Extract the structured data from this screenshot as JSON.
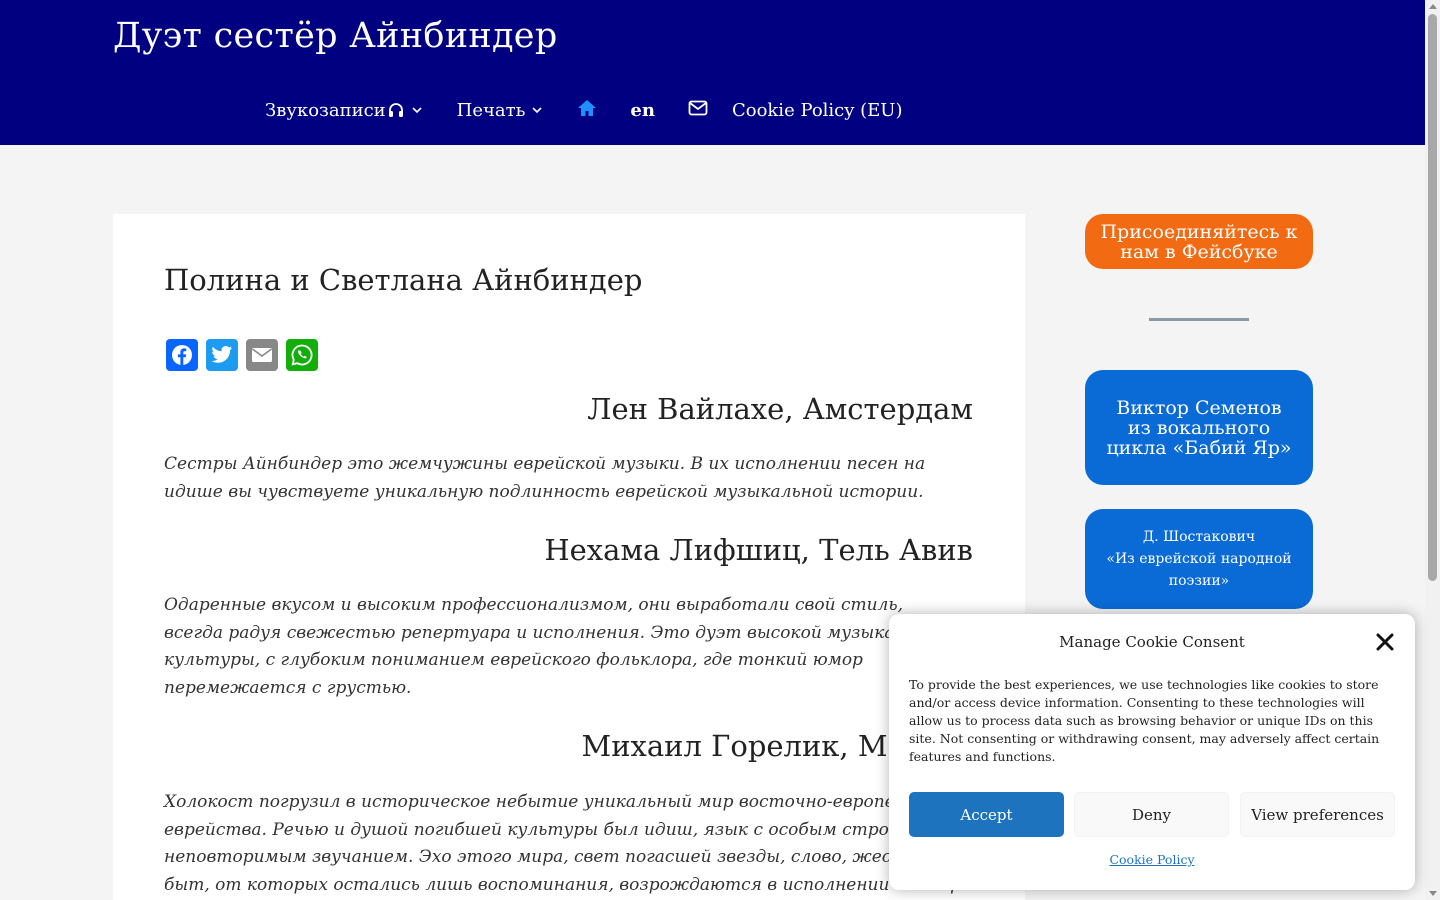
{
  "header": {
    "site_title": "Дуэт сестёр Айнбиндер",
    "nav": {
      "recordings_label": "Звукозаписи",
      "print_label": "Печать",
      "home_icon": "home-icon",
      "lang_label": "en",
      "mail_icon": "envelope-icon",
      "cookie_policy_label": "Cookie Policy (EU)"
    }
  },
  "content": {
    "page_title": "Полина и Светлана Айнбиндер",
    "share_buttons": [
      "Facebook",
      "Twitter",
      "Email",
      "WhatsApp"
    ],
    "reviews": [
      {
        "author": "Лен Вайлахе, Амстердам",
        "text": "Сестры Айнбиндер это жемчужины еврейской музыки. В их исполнении песен на идише вы чувствуете уникальную подлинность еврейской музыкальной истории."
      },
      {
        "author": "Нехама Лифшиц, Тель Авив",
        "text": "Одаренные вкусом и высоким профессионализмом, они выработали свой стиль, всегда радуя свежестью репертуара и исполнения. Это дуэт высокой музыкальной культуры, с глубоким пониманием еврейского фольклора, где тонкий юмор перемежается с грустью."
      },
      {
        "author": "Михаил Горелик, Москва",
        "text": "Холокост погрузил в историческое небытие уникальный мир восточно-европейского еврейства. Речью и душой погибшей культуры был идиш, язык с особым строем и неповторимым звучанием. Эхо этого мира, свет погасшей звезды, слово, жест и быт, от которых остались лишь воспоминания, возрождаются в исполнении сестёр"
      }
    ]
  },
  "sidebar": {
    "facebook_button": "Присоединяйтесь к нам в Фейсбуке",
    "victor_button": "Виктор Семенов из вокального цикла «Бабий Яр»",
    "shostakovich_line1": "Д. Шостакович",
    "shostakovich_line2": "«Из еврейской народной поэзии»"
  },
  "cookie_banner": {
    "title": "Manage Cookie Consent",
    "text": "To provide the best experiences, we use technologies like cookies to store and/or access device information. Consenting to these technologies will allow us to process data such as browsing behavior or unique IDs on this site. Not consenting or withdrawing consent, may adversely affect certain features and functions.",
    "accept_label": "Accept",
    "deny_label": "Deny",
    "preferences_label": "View preferences",
    "policy_link": "Cookie Policy"
  },
  "colors": {
    "header_bg": "#000080",
    "home_icon": "#1e90ff",
    "facebook_cta": "#f26a11",
    "sidebar_button": "#0a6ad6",
    "accept_button": "#1e73be"
  }
}
